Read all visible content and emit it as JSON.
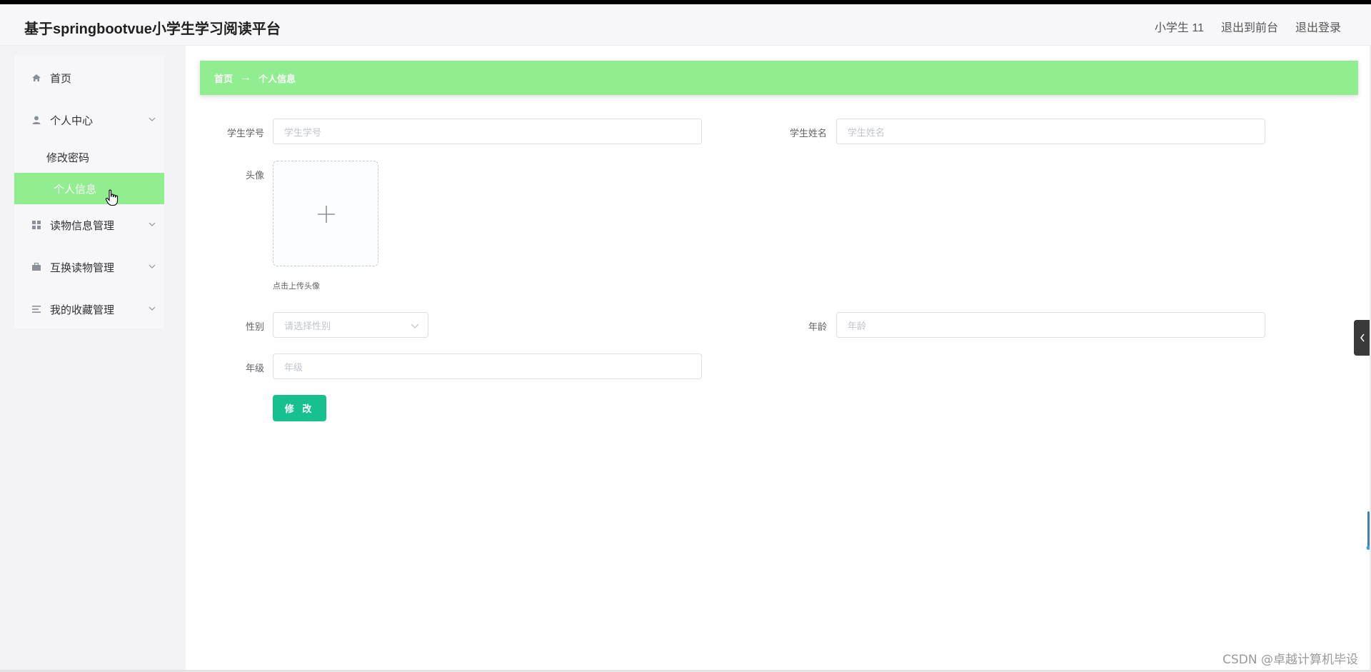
{
  "app": {
    "title": "基于springbootvue小学生学习阅读平台"
  },
  "header": {
    "username": "小学生 11",
    "back_to_front": "退出到前台",
    "logout": "退出登录"
  },
  "sidebar": {
    "home": "首页",
    "personal_center": "个人中心",
    "change_password": "修改密码",
    "personal_info": "个人信息",
    "reading_mgmt": "读物信息管理",
    "exchange_mgmt": "互换读物管理",
    "favorites_mgmt": "我的收藏管理"
  },
  "breadcrumb": {
    "home": "首页",
    "arrow": "→",
    "current": "个人信息"
  },
  "form": {
    "student_no_label": "学生学号",
    "student_no_placeholder": "学生学号",
    "student_name_label": "学生姓名",
    "student_name_placeholder": "学生姓名",
    "avatar_label": "头像",
    "avatar_hint": "点击上传头像",
    "gender_label": "性别",
    "gender_placeholder": "请选择性别",
    "age_label": "年龄",
    "age_placeholder": "年龄",
    "grade_label": "年级",
    "grade_placeholder": "年级",
    "submit_label": "修 改"
  },
  "watermark": "CSDN @卓越计算机毕设",
  "colors": {
    "accent_green": "#90ee90",
    "button_teal": "#17c08f"
  }
}
